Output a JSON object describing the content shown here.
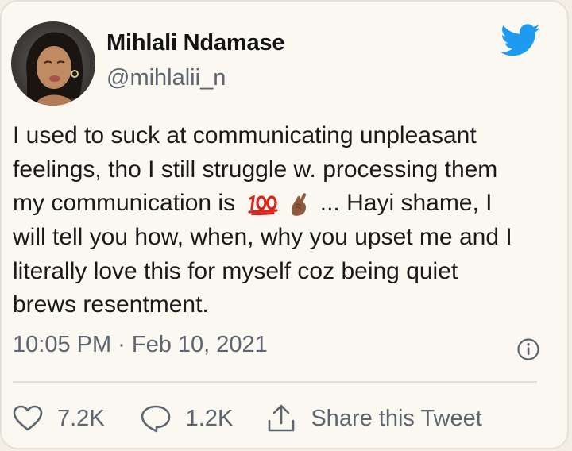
{
  "tweet": {
    "author_name": "Mihlali Ndamase",
    "author_handle": "@mihlalii_n",
    "text_part1": "I used to suck at communicating unpleasant\nfeelings, tho I still struggle w. processing them\nmy communication is ",
    "emoji_100": "💯",
    "emoji_fingers_crossed": "🤞🏾",
    "text_part2": " ... Hayi shame, I\nwill tell you how, when, why you upset me and I\nliterally love this for myself coz being quiet\nbrews resentment.",
    "timestamp": "10:05 PM · Feb 10, 2021"
  },
  "actions": {
    "likes": "7.2K",
    "replies": "1.2K",
    "share_label": "Share this Tweet"
  },
  "colors": {
    "card_background": "#fbf8f2",
    "muted_text": "#5d6670",
    "twitter_blue": "#1d9bf0",
    "hundred_red": "#d9251d"
  },
  "icons": {
    "brand": "twitter-bird-icon",
    "info": "info-icon",
    "like": "heart-icon",
    "reply": "speech-bubble-icon",
    "share": "share-upload-icon"
  }
}
